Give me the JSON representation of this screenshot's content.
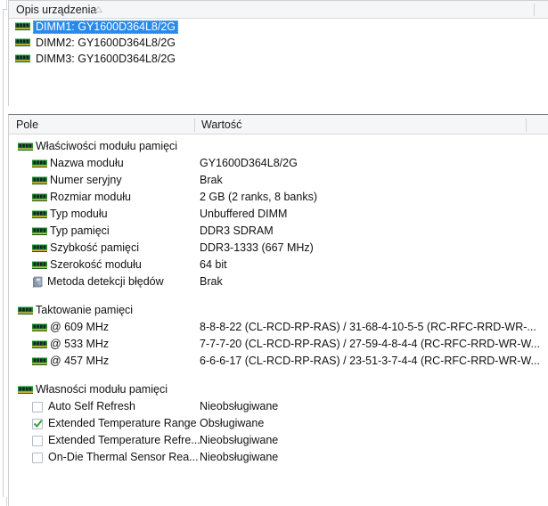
{
  "device_list": {
    "header": {
      "column_label": "Opis urządzenia",
      "sort_indicator": "sort-ascending-arrow"
    },
    "rows": [
      {
        "label": "DIMM1: GY1600D364L8/2G",
        "icon": "memory-module-icon",
        "selected": true
      },
      {
        "label": "DIMM2: GY1600D364L8/2G",
        "icon": "memory-module-icon",
        "selected": false
      },
      {
        "label": "DIMM3: GY1600D364L8/2G",
        "icon": "memory-module-icon",
        "selected": false
      }
    ]
  },
  "details": {
    "header": {
      "field_label": "Pole",
      "value_label": "Wartość"
    },
    "sections": [
      {
        "title": "Właściwości modułu pamięci",
        "icon": "memory-module-icon",
        "rows": [
          {
            "icon": "memory-module-icon",
            "label": "Nazwa modułu",
            "value": "GY1600D364L8/2G"
          },
          {
            "icon": "memory-module-icon",
            "label": "Numer seryjny",
            "value": "Brak"
          },
          {
            "icon": "memory-module-icon",
            "label": "Rozmiar modułu",
            "value": "2 GB (2 ranks, 8 banks)"
          },
          {
            "icon": "memory-module-icon",
            "label": "Typ modułu",
            "value": "Unbuffered DIMM"
          },
          {
            "icon": "memory-module-icon",
            "label": "Typ pamięci",
            "value": "DDR3 SDRAM"
          },
          {
            "icon": "memory-module-icon",
            "label": "Szybkość pamięci",
            "value": "DDR3-1333 (667 MHz)"
          },
          {
            "icon": "memory-module-icon",
            "label": "Szerokość modułu",
            "value": "64 bit"
          },
          {
            "icon": "computer-icon",
            "label": "Metoda detekcji błędów",
            "value": "Brak"
          }
        ]
      },
      {
        "title": "Taktowanie pamięci",
        "icon": "memory-module-icon",
        "rows": [
          {
            "icon": "memory-module-icon",
            "label": "@ 609 MHz",
            "value": "8-8-8-22  (CL-RCD-RP-RAS) / 31-68-4-10-5-5  (RC-RFC-RRD-WR-..."
          },
          {
            "icon": "memory-module-icon",
            "label": "@ 533 MHz",
            "value": "7-7-7-20  (CL-RCD-RP-RAS) / 27-59-4-8-4-4  (RC-RFC-RRD-WR-W..."
          },
          {
            "icon": "memory-module-icon",
            "label": "@ 457 MHz",
            "value": "6-6-6-17  (CL-RCD-RP-RAS) / 23-51-3-7-4-4  (RC-RFC-RRD-WR-W..."
          }
        ]
      },
      {
        "title": "Własności modułu pamięci",
        "icon": "memory-module-icon",
        "rows": [
          {
            "icon": "checkbox-unchecked",
            "label": "Auto Self Refresh",
            "value": "Nieobsługiwane"
          },
          {
            "icon": "checkbox-checked",
            "label": "Extended Temperature Range",
            "value": "Obsługiwane"
          },
          {
            "icon": "checkbox-unchecked",
            "label": "Extended Temperature Refre...",
            "value": "Nieobsługiwane"
          },
          {
            "icon": "checkbox-unchecked",
            "label": "On-Die Thermal Sensor Rea...",
            "value": "Nieobsługiwane"
          }
        ]
      }
    ]
  },
  "colors": {
    "selection": "#2a8aea",
    "header_bg": "#f5f6f7",
    "pcb_green": "#1f8c2a",
    "check_green": "#3aa13a"
  }
}
